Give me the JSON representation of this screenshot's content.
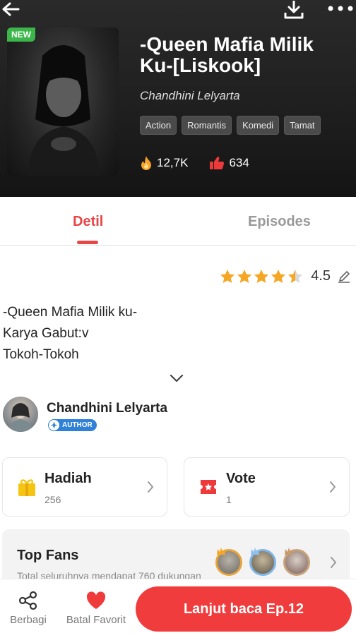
{
  "header": {
    "badge": "NEW",
    "title": "-Queen Mafia Milik Ku-[Liskook]",
    "author": "Chandhini Lelyarta",
    "tags": [
      "Action",
      "Romantis",
      "Komedi",
      "Tamat"
    ],
    "views": "12,7K",
    "likes": "634"
  },
  "tabs": [
    {
      "label": "Detil",
      "active": true
    },
    {
      "label": "Episodes",
      "active": false
    }
  ],
  "rating": {
    "value": "4.5",
    "stars": 4.5
  },
  "synopsis": {
    "lines": [
      "-Queen Mafia Milik ku-",
      "Karya Gabut:v",
      "Tokoh-Tokoh"
    ]
  },
  "author": {
    "name": "Chandhini Lelyarta",
    "badge": "AUTHOR"
  },
  "cards": {
    "gift": {
      "label": "Hadiah",
      "count": "256"
    },
    "vote": {
      "label": "Vote",
      "count": "1"
    }
  },
  "fans": {
    "label": "Top Fans",
    "subtitle": "Total seluruhnya mendapat 760 dukungan"
  },
  "bottom": {
    "share": "Berbagi",
    "favorite": "Batal Favorit",
    "read": "Lanjut baca Ep.12"
  },
  "colors": {
    "accent": "#f03c3c",
    "new_badge": "#3cb64b",
    "star": "#f5a623",
    "author_badge": "#2f80d9"
  },
  "icons": [
    "back-arrow-icon",
    "download-icon",
    "more-icon",
    "fire-icon",
    "thumbs-up-icon",
    "star-icon",
    "edit-icon",
    "chevron-down-icon",
    "gift-icon",
    "ticket-icon",
    "chevron-right-icon",
    "share-icon",
    "heart-icon",
    "crown-icon"
  ]
}
